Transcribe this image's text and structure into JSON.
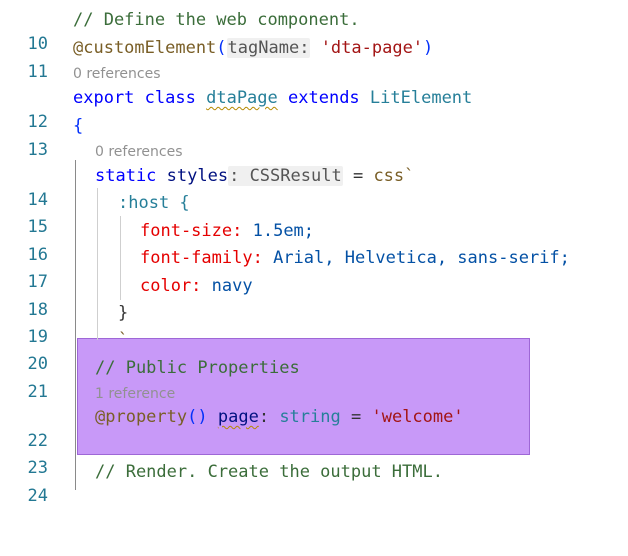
{
  "colors": {
    "selection": "#c899f8",
    "line_number": "#237893",
    "comment": "#3b6d3a",
    "keyword": "#0000ff",
    "string": "#a31515",
    "codelens": "#919191"
  },
  "line_numbers": [
    "10",
    "11",
    "12",
    "13",
    "14",
    "15",
    "16",
    "17",
    "18",
    "19",
    "20",
    "21",
    "22",
    "23",
    "24"
  ],
  "codelens": {
    "l11": "0 references",
    "l13": "0 references",
    "l21": "1 reference"
  },
  "code": {
    "l10": {
      "comment": "// Define the web component."
    },
    "l11": {
      "decorator": "@customElement",
      "open": "(",
      "hint": "tagName:",
      "arg": "'dta-page'",
      "close": ")"
    },
    "l12": {
      "kw1": "export",
      "kw2": "class",
      "name": "dtaPage",
      "kw3": "extends",
      "base": "LitElement"
    },
    "l13": {
      "brace": "{"
    },
    "l14": {
      "kw": "static",
      "prop": "styles",
      "hint": ": CSSResult",
      "eq": "=",
      "tag": "css`"
    },
    "l15": {
      "selector": ":host {"
    },
    "l16": {
      "prop": "font-size:",
      "val": "1.5em;"
    },
    "l17": {
      "prop": "font-family:",
      "val": "Arial, Helvetica, sans-serif;"
    },
    "l18": {
      "prop": "color:",
      "val": "navy"
    },
    "l19": {
      "brace": "}"
    },
    "l20": {
      "tick": "`"
    },
    "l21": {
      "comment": "// Public Properties"
    },
    "l22": {
      "decorator": "@property",
      "parens": "()",
      "name": "page",
      "colon": ":",
      "type": "string",
      "eq": "=",
      "val": "'welcome'"
    },
    "l23": {
      "text": ""
    },
    "l24": {
      "comment": "// Render. Create the output HTML."
    }
  }
}
